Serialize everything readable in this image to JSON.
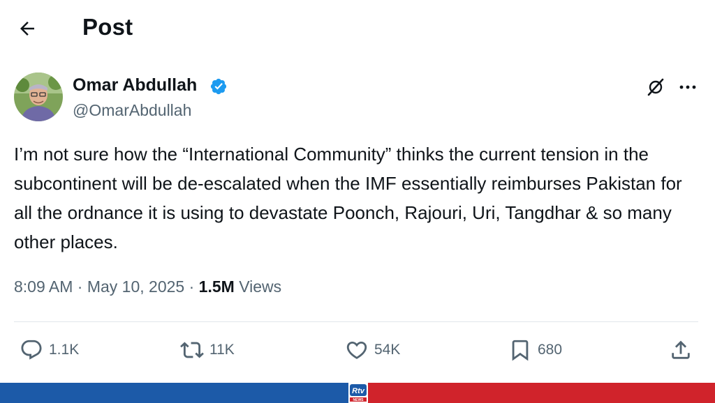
{
  "header": {
    "back_icon": "arrow-left-icon",
    "title": "Post"
  },
  "author": {
    "name": "Omar Abdullah",
    "handle": "@OmarAbdullah",
    "verified": true,
    "verified_color": "#1d9bf0"
  },
  "post": {
    "text": "I’m not sure how the “International Community” thinks the current tension in the subcontinent will be de-escalated when the IMF essentially reimburses Pakistan for all the ordnance it is using to devastate Poonch, Rajouri, Uri, Tangdhar & so many other places.",
    "time": "8:09 AM",
    "separator": "·",
    "date": "May 10, 2025",
    "views_count": "1.5M",
    "views_label": "Views"
  },
  "actions": {
    "replies": "1.1K",
    "reposts": "11K",
    "likes": "54K",
    "bookmarks": "680"
  },
  "banner": {
    "left_color": "#1c5aa8",
    "right_color": "#d0232b",
    "logo_text": "Rtv",
    "logo_subtext": "NEWS"
  }
}
